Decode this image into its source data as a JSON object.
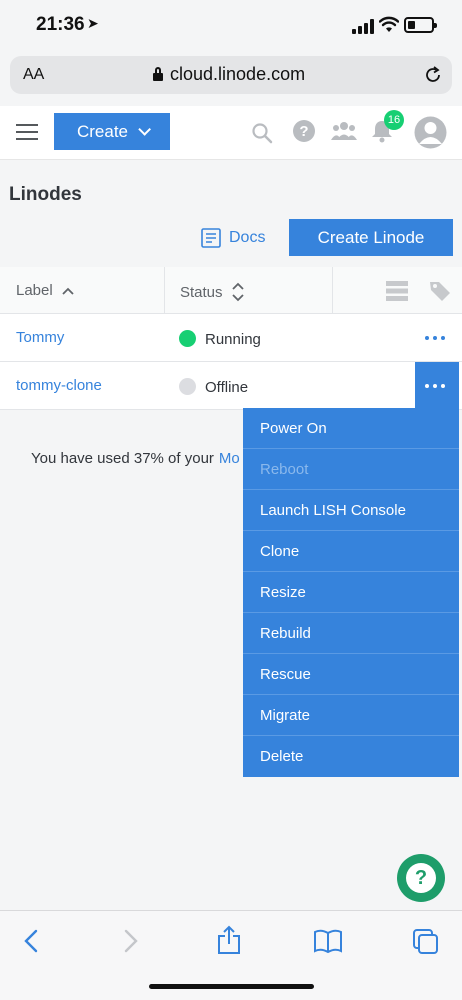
{
  "status_bar": {
    "time": "21:36"
  },
  "browser": {
    "text_size_label": "AA",
    "url": "cloud.linode.com"
  },
  "header": {
    "create_label": "Create",
    "notification_count": "16"
  },
  "page": {
    "title": "Linodes",
    "docs_label": "Docs",
    "create_linode_label": "Create Linode"
  },
  "table": {
    "columns": {
      "label": "Label",
      "status": "Status"
    },
    "rows": [
      {
        "label": "Tommy",
        "status": "Running",
        "status_color": "#17cf73"
      },
      {
        "label": "tommy-clone",
        "status": "Offline",
        "status_color": "#dcdde1"
      }
    ]
  },
  "usage": {
    "text": "You have used 37% of your",
    "link": "Mo"
  },
  "action_menu": {
    "items": [
      {
        "label": "Power On",
        "disabled": false
      },
      {
        "label": "Reboot",
        "disabled": true
      },
      {
        "label": "Launch LISH Console",
        "disabled": false
      },
      {
        "label": "Clone",
        "disabled": false
      },
      {
        "label": "Resize",
        "disabled": false
      },
      {
        "label": "Rebuild",
        "disabled": false
      },
      {
        "label": "Rescue",
        "disabled": false
      },
      {
        "label": "Migrate",
        "disabled": false
      },
      {
        "label": "Delete",
        "disabled": false
      }
    ]
  },
  "colors": {
    "accent": "#3683dc",
    "running": "#17cf73",
    "help": "#1e9d6a"
  },
  "icons": [
    "location-arrow-icon",
    "signal-icon",
    "wifi-icon",
    "battery-icon",
    "lock-icon",
    "reload-icon",
    "hamburger-icon",
    "search-icon",
    "help-icon",
    "community-icon",
    "bell-icon",
    "avatar-icon",
    "docs-icon",
    "sort-asc-icon",
    "sort-icon",
    "list-view-icon",
    "tag-icon",
    "more-icon",
    "back-icon",
    "forward-icon",
    "share-icon",
    "bookmarks-icon",
    "tabs-icon"
  ]
}
